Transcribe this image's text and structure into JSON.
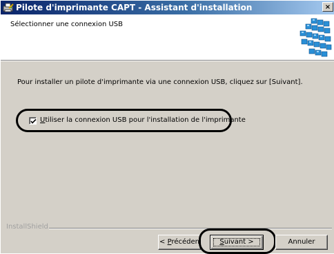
{
  "window": {
    "title": "Pilote d'imprimante CAPT - Assistant d'installation",
    "close_label": "×",
    "titlebar_colors": [
      "#0a246a",
      "#3a6ea5",
      "#a6caf0"
    ]
  },
  "header": {
    "title": "Sélectionner une connexion USB"
  },
  "main": {
    "instruction": "Pour installer un pilote d'imprimante via une connexion USB, cliquez sur [Suivant].",
    "checkbox": {
      "checked": true,
      "mnemonic": "U",
      "label_rest": "tiliser la connexion USB pour l'installation de l'imprimante"
    }
  },
  "footer": {
    "brand": "InstallShield",
    "buttons": {
      "back": {
        "prefix": "< ",
        "mnemonic": "P",
        "rest": "récéden"
      },
      "next": {
        "mnemonic": "S",
        "rest": "uivant >"
      },
      "cancel": {
        "label": "Annuler"
      }
    }
  }
}
